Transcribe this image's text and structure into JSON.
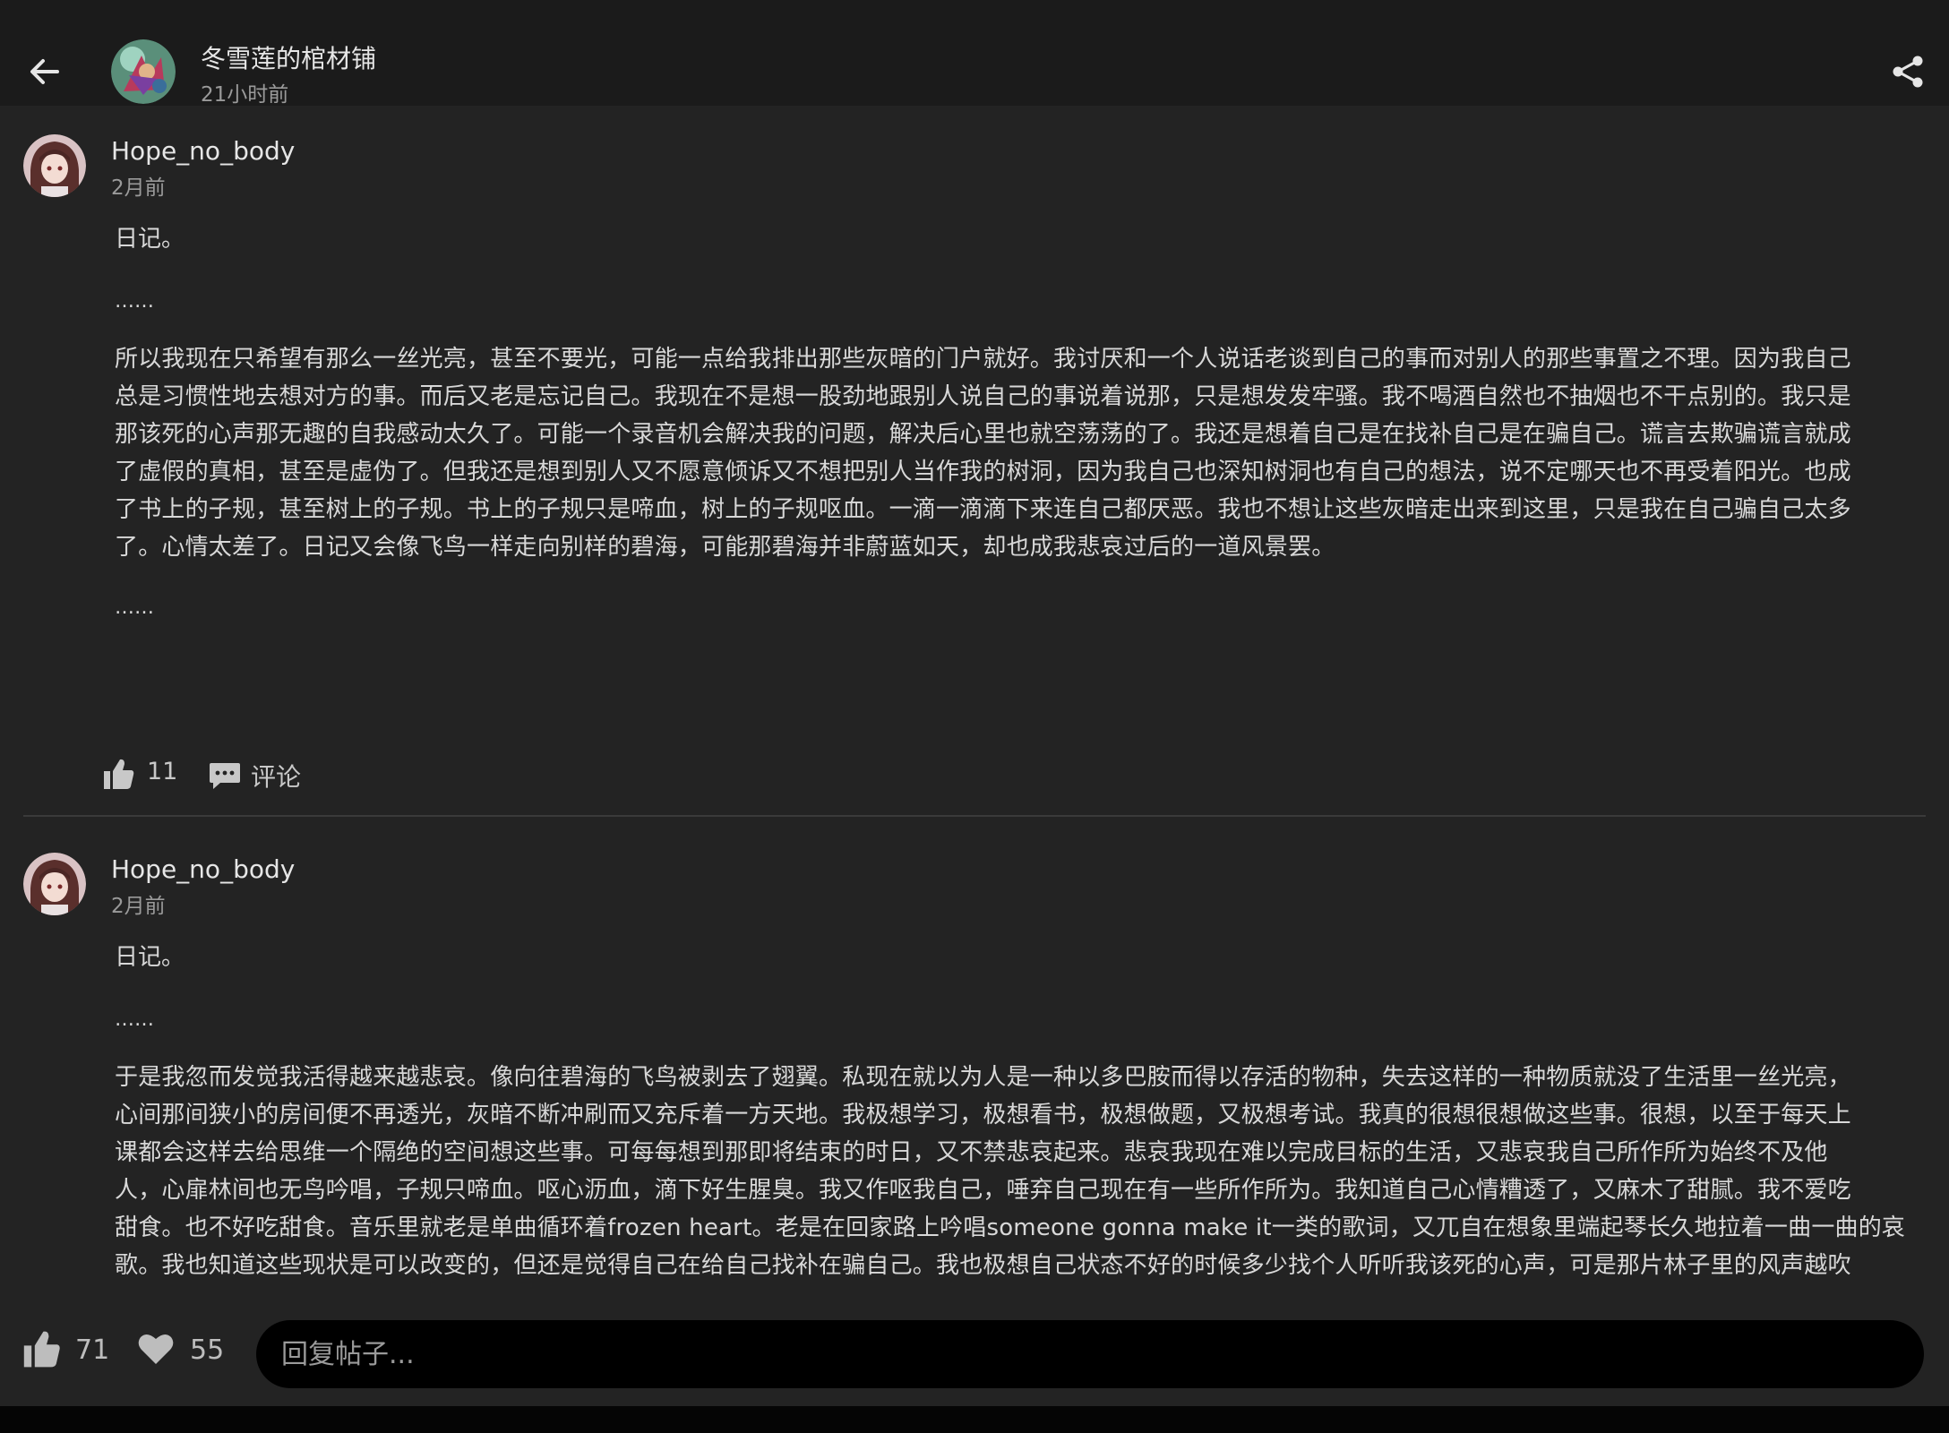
{
  "header": {
    "title": "冬雪莲的棺材铺",
    "time": "21小时前",
    "back_icon": "arrow-left-icon",
    "share_icon": "share-icon"
  },
  "posts": [
    {
      "author": "Hope_no_body",
      "time": "2月前",
      "heading": "日记。",
      "ellipsis_top": "……",
      "lines": [
        "所以我现在只希望有那么一丝光亮，甚至不要光，可能一点给我排出那些灰暗的门户就好。我讨厌和一个人说话老谈到自己的事而对别人的那些事置之不理。因为我自己",
        "总是习惯性地去想对方的事。而后又老是忘记自己。我现在不是想一股劲地跟别人说自己的事说着说那，只是想发发牢骚。我不喝酒自然也不抽烟也不干点别的。我只是",
        "那该死的心声那无趣的自我感动太久了。可能一个录音机会解决我的问题，解决后心里也就空荡荡的了。我还是想着自己是在找补自己是在骗自己。谎言去欺骗谎言就成",
        "了虚假的真相，甚至是虚伪了。但我还是想到别人又不愿意倾诉又不想把别人当作我的树洞，因为我自己也深知树洞也有自己的想法，说不定哪天也不再受着阳光。也成",
        "了书上的子规，甚至树上的子规。书上的子规只是啼血，树上的子规呕血。一滴一滴滴下来连自己都厌恶。我也不想让这些灰暗走出来到这里，只是我在自己骗自己太多",
        "了。心情太差了。日记又会像飞鸟一样走向别样的碧海，可能那碧海并非蔚蓝如天，却也成我悲哀过后的一道风景罢。"
      ],
      "ellipsis_bottom": "……",
      "likes": "11",
      "comment_label": "评论"
    },
    {
      "author": "Hope_no_body",
      "time": "2月前",
      "heading": "日记。",
      "ellipsis_top": "……",
      "lines": [
        "于是我忽而发觉我活得越来越悲哀。像向往碧海的飞鸟被剥去了翅翼。私现在就以为人是一种以多巴胺而得以存活的物种，失去这样的一种物质就没了生活里一丝光亮，",
        "心间那间狭小的房间便不再透光，灰暗不断冲刷而又充斥着一方天地。我极想学习，极想看书，极想做题，又极想考试。我真的很想很想做这些事。很想，以至于每天上",
        "课都会这样去给思维一个隔绝的空间想这些事。可每每想到那即将结束的时日，又不禁悲哀起来。悲哀我现在难以完成目标的生活，又悲哀我自己所作所为始终不及他",
        "人，心扉林间也无鸟吟唱，子规只啼血。呕心沥血，滴下好生腥臭。我又作呕我自己，唾弃自己现在有一些所作所为。我知道自己心情糟透了，又麻木了甜腻。我不爱吃",
        "甜食。也不好吃甜食。音乐里就老是单曲循环着frozen heart。老是在回家路上吟唱someone gonna make it一类的歌词，又兀自在想象里端起琴长久地拉着一曲一曲的哀",
        "歌。我也知道这些现状是可以改变的，但还是觉得自己在给自己找补在骗自己。我也极想自己状态不好的时候多少找个人听听我该死的心声，可是那片林子里的风声越吹"
      ]
    }
  ],
  "bottom_bar": {
    "likes": "71",
    "hearts": "55",
    "reply_placeholder": "回复帖子..."
  },
  "colors": {
    "background": "#232323",
    "header_bg": "#1b1b1b",
    "input_bg": "#000000"
  }
}
